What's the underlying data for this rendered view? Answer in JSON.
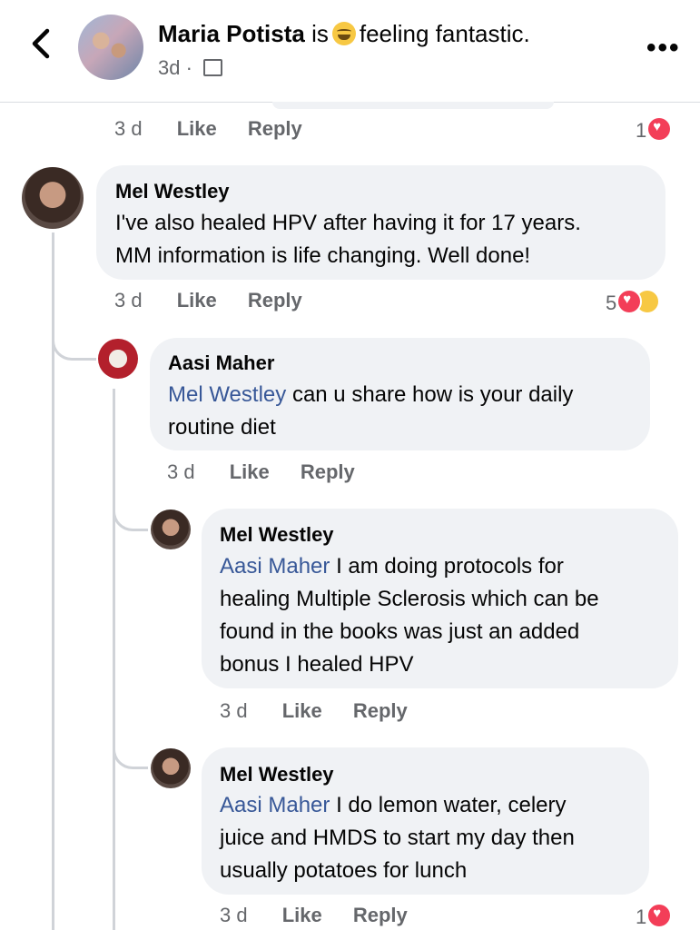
{
  "header": {
    "name": "Maria Potista",
    "is": "is",
    "feeling": "feeling fantastic.",
    "time": "3d",
    "dot": "·"
  },
  "actions": {
    "like": "Like",
    "reply": "Reply"
  },
  "top_row": {
    "time": "3 d",
    "reactions": "1"
  },
  "comments": [
    {
      "author": "Mel Westley",
      "text_lines": [
        "I've also healed HPV after having it for 17 years.",
        "MM information is life changing. Well done!"
      ],
      "time": "3 d",
      "reactions": "5"
    },
    {
      "author": "Aasi Maher",
      "mention": "Mel Westley",
      "line1_rest": "can u share how is your daily",
      "line2": "routine diet",
      "time": "3 d"
    },
    {
      "author": "Mel Westley",
      "mention": "Aasi Maher",
      "line1_rest": "I am doing protocols for",
      "line2": "healing Multiple Sclerosis which can be",
      "line3": "found in the books was just an added",
      "line4": "bonus I healed HPV",
      "time": "3 d"
    },
    {
      "author": "Mel Westley",
      "mention": "Aasi Maher",
      "line1_rest": "I do lemon water, celery",
      "line2": "juice and HMDS to start my day then",
      "line3": "usually potatoes for lunch",
      "time": "3 d",
      "reactions": "1"
    }
  ]
}
